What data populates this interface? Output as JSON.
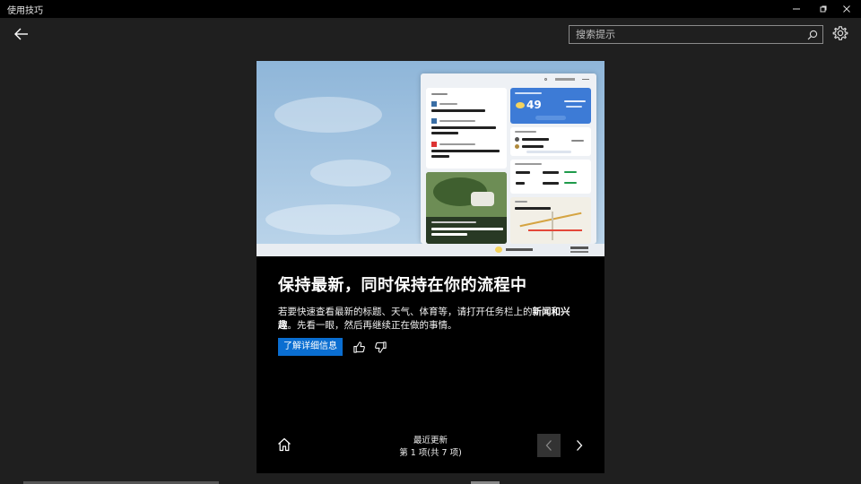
{
  "window": {
    "title": "使用技巧",
    "controls": [
      "minimize-icon",
      "maximize-icon",
      "close-icon"
    ]
  },
  "header": {
    "back_icon": "arrow-left-icon",
    "search": {
      "placeholder": "搜索提示",
      "value": "",
      "icon": "search-icon"
    },
    "settings_icon": "gear-icon"
  },
  "tip": {
    "headline": "保持最新，同时保持在你的流程中",
    "description_before": "若要快速查看最新的标题、天气、体育等，请打开任务栏上的",
    "description_bold": "新闻和兴趣",
    "description_after": "。先看一眼，然后再继续正在做的事情。",
    "learn_more_label": "了解详细信息",
    "like_icon": "thumbs-up-icon",
    "dislike_icon": "thumbs-down-icon"
  },
  "footer": {
    "home_icon": "home-icon",
    "section_label": "最近更新",
    "position_label": "第 1 项(共 7 项)",
    "prev_icon": "chevron-left-icon",
    "next_icon": "chevron-right-icon"
  },
  "colors": {
    "accent": "#0a6ed1",
    "background": "#1f1f1f",
    "card": "#000000",
    "titlebar": "#000000"
  }
}
